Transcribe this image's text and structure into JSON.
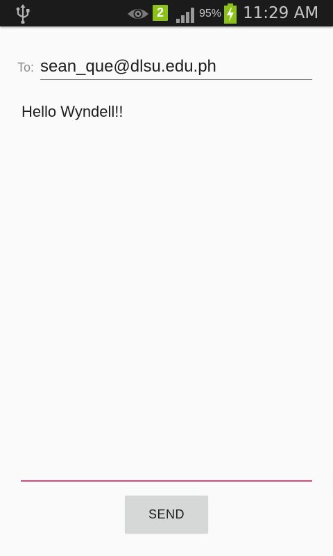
{
  "status_bar": {
    "icons": [
      "usb-icon",
      "eye-icon",
      "signal-icon",
      "battery-charging-icon"
    ],
    "notification_count": "2",
    "battery_percent": "95%",
    "time": "11:29 AM",
    "colors": {
      "background": "#1b1b1b",
      "text": "#c8c8c8",
      "badge": "#8cc11a",
      "battery": "#8cc11a"
    }
  },
  "compose": {
    "to_label": "To:",
    "to_value": "sean_que@dlsu.edu.ph",
    "message": "Hello Wyndell!!",
    "send_label": "SEND",
    "colors": {
      "focus_underline": "#e0457b",
      "button": "#d6d7d7"
    }
  }
}
